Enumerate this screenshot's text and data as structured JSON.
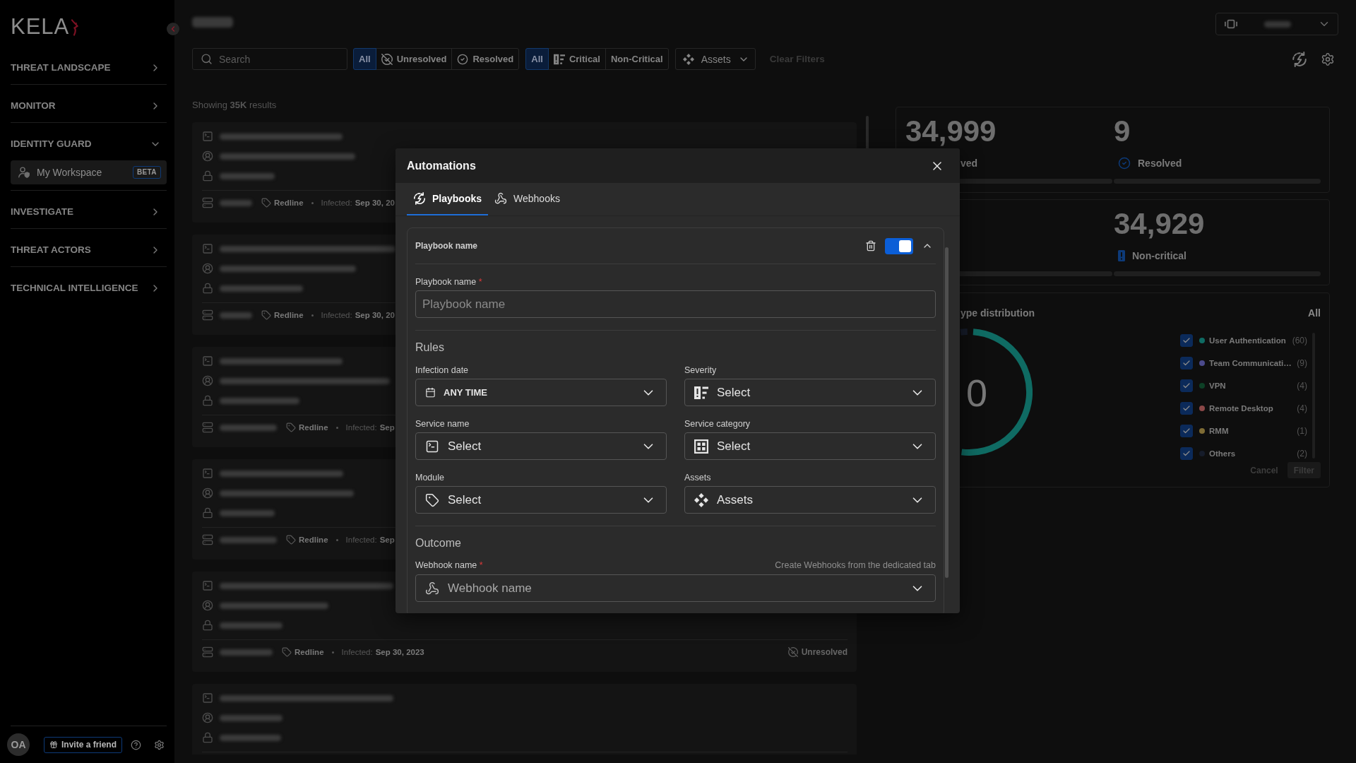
{
  "sidebar": {
    "logo": "KELA",
    "items": [
      {
        "label": "THREAT LANDSCAPE",
        "expanded": false
      },
      {
        "label": "MONITOR",
        "expanded": false
      },
      {
        "label": "IDENTITY GUARD",
        "expanded": true,
        "children": [
          {
            "label": "My Workspace",
            "badge": "BETA",
            "selected": true
          }
        ]
      },
      {
        "label": "INVESTIGATE",
        "expanded": false
      },
      {
        "label": "THREAT ACTORS",
        "expanded": false
      },
      {
        "label": "TECHNICAL INTELLIGENCE",
        "expanded": false
      }
    ],
    "footer": {
      "avatar": "OA",
      "invite": "Invite a friend"
    }
  },
  "filters": {
    "search": {
      "placeholder": "Search"
    },
    "status": [
      {
        "label": "All",
        "selected": true
      },
      {
        "label": "Unresolved",
        "selected": false
      },
      {
        "label": "Resolved",
        "selected": false
      }
    ],
    "severity": [
      {
        "label": "All",
        "selected": true
      },
      {
        "label": "Critical",
        "selected": false
      },
      {
        "label": "Non-Critical",
        "selected": false
      }
    ],
    "assets": {
      "label": "Assets"
    },
    "clear": {
      "label": "Clear Filters",
      "disabled": true
    }
  },
  "results": {
    "summary": "Showing **35K** results",
    "cards": [
      {
        "kind": "full",
        "module": "Redline",
        "infected_label": "Infected:",
        "infected_date": "Sep 30, 20"
      },
      {
        "kind": "full",
        "module": "Redline",
        "infected_label": "Infected:",
        "infected_date": "Sep 30, 20"
      },
      {
        "kind": "full",
        "module": "Redline",
        "infected_label": "Infected:",
        "infected_date": "Sep"
      },
      {
        "kind": "full",
        "module": "Redline",
        "infected_label": "Infected:",
        "infected_date": "Sep"
      },
      {
        "kind": "full",
        "module": "Redline",
        "infected_label": "Infected:",
        "infected_date": "Sep 30, 2023",
        "status": "Unresolved"
      },
      {
        "kind": "cut"
      }
    ]
  },
  "stat_cards": [
    {
      "cells": [
        {
          "kind": "partial",
          "value": "34,999",
          "label": "ved"
        },
        {
          "kind": "full",
          "value": "9",
          "label": "Resolved"
        }
      ]
    },
    {
      "cells": [
        {
          "kind": "covered"
        },
        {
          "kind": "full",
          "value": "34,929",
          "label": "Non-critical"
        }
      ]
    }
  ],
  "distribution": {
    "title": "ype distribution",
    "filter_label": "All",
    "center_value": "0",
    "legend": [
      {
        "label": "User Authentication",
        "count": "(60)",
        "color": "#0f6b63",
        "checked": true
      },
      {
        "label": "Team Communicati…",
        "count": "(9)",
        "color": "#4b4a8c",
        "checked": true
      },
      {
        "label": "VPN",
        "count": "(4)",
        "color": "#0d4026",
        "checked": true
      },
      {
        "label": "Remote Desktop",
        "count": "(4)",
        "color": "#8b4848",
        "checked": true
      },
      {
        "label": "RMM",
        "count": "(1)",
        "color": "#7f6c35",
        "checked": true
      },
      {
        "label": "Others",
        "count": "(2)",
        "color": "#161c2a",
        "checked": true
      }
    ],
    "cancel": "Cancel",
    "apply": "Filter"
  },
  "dialog": {
    "title": "Automations",
    "tabs": [
      {
        "label": "Playbooks",
        "selected": true
      },
      {
        "label": "Webhooks",
        "selected": false
      }
    ],
    "playbook": {
      "title": "Playbook name",
      "enabled": true,
      "expanded": true,
      "name_field": {
        "label": "Playbook name",
        "required_mark": "*",
        "placeholder": "Playbook name"
      },
      "rules_heading": "Rules",
      "rules": [
        {
          "label": "Infection date",
          "value": "ANY TIME"
        },
        {
          "label": "Severity",
          "placeholder": "Select"
        },
        {
          "label": "Service name",
          "placeholder": "Select"
        },
        {
          "label": "Service category",
          "placeholder": "Select"
        },
        {
          "label": "Module",
          "placeholder": "Select"
        },
        {
          "label": "Assets",
          "placeholder": "Assets"
        }
      ],
      "outcome_heading": "Outcome",
      "webhook_field": {
        "label": "Webhook name",
        "required_mark": "*",
        "hint": "Create Webhooks from the dedicated tab",
        "placeholder": "Webhook name"
      }
    }
  }
}
